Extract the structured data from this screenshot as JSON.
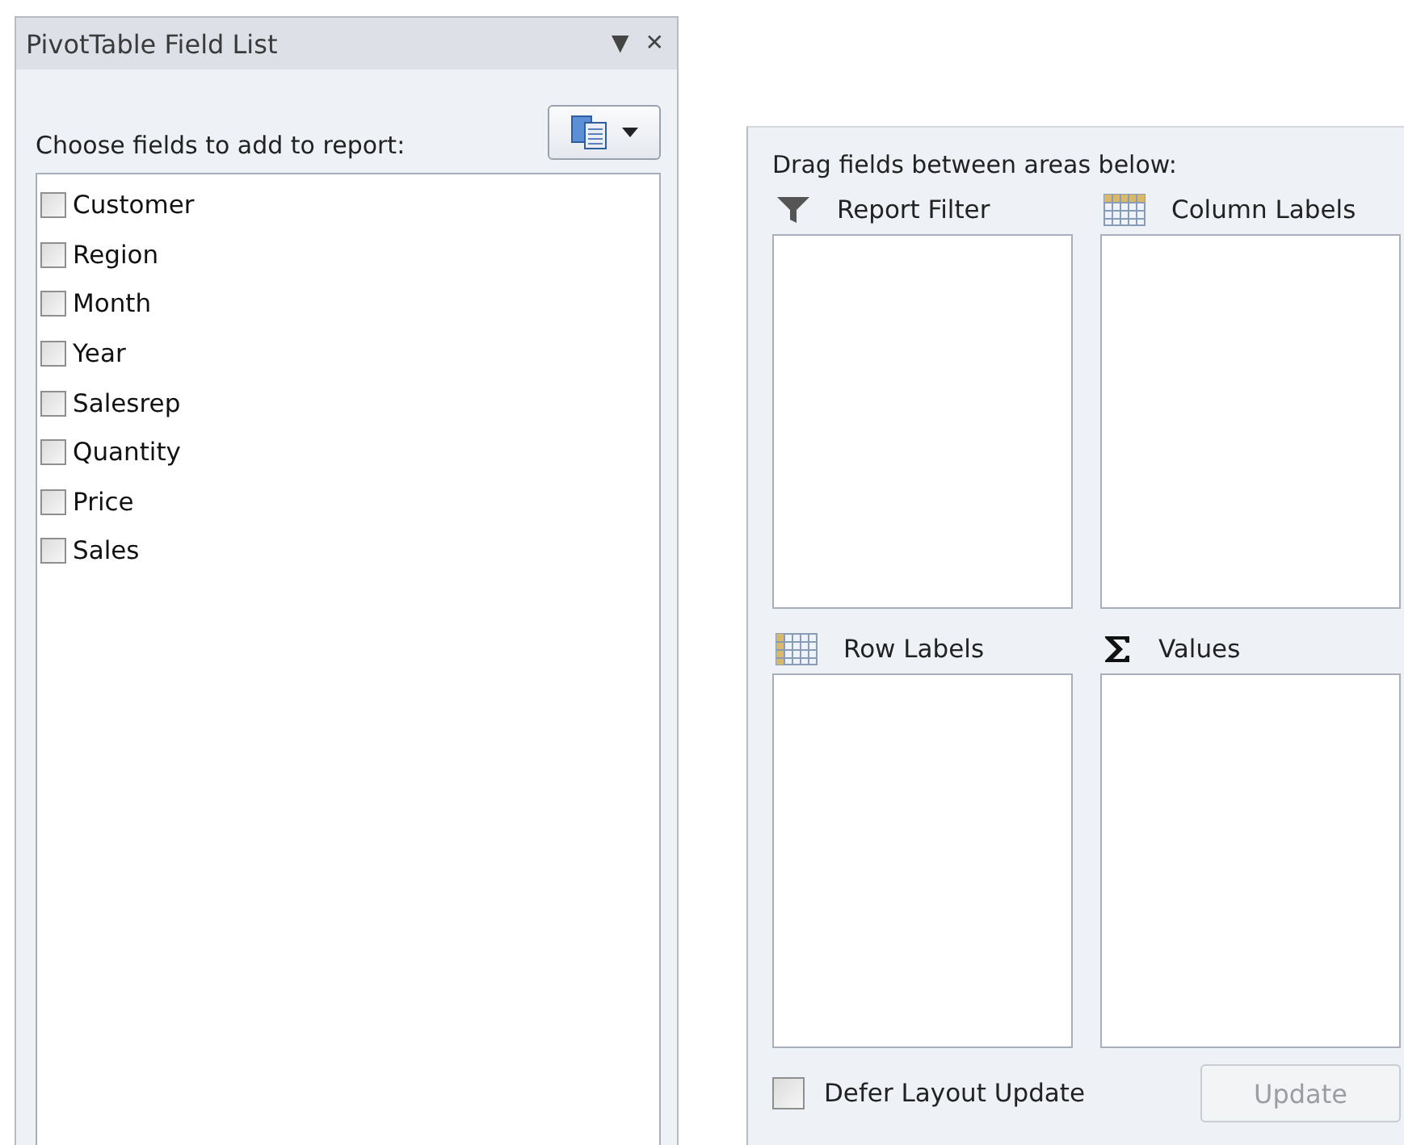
{
  "field_list": {
    "title": "PivotTable Field List",
    "dropdown_glyph": "▼",
    "close_glyph": "✕",
    "prompt": "Choose fields to add to report:",
    "fields": [
      {
        "label": "Customer",
        "checked": false
      },
      {
        "label": "Region",
        "checked": false
      },
      {
        "label": "Month",
        "checked": false
      },
      {
        "label": "Year",
        "checked": false
      },
      {
        "label": "Salesrep",
        "checked": false
      },
      {
        "label": "Quantity",
        "checked": false
      },
      {
        "label": "Price",
        "checked": false
      },
      {
        "label": "Sales",
        "checked": false
      }
    ]
  },
  "areas_panel": {
    "prompt": "Drag fields between areas below:",
    "areas": [
      {
        "kind": "filter",
        "label": "Report Filter"
      },
      {
        "kind": "columns",
        "label": "Column Labels"
      },
      {
        "kind": "rows",
        "label": "Row Labels"
      },
      {
        "kind": "values",
        "label": "Values"
      }
    ],
    "defer": {
      "label": "Defer Layout Update",
      "checked": false
    },
    "update_button": {
      "label": "Update",
      "disabled": true
    }
  }
}
